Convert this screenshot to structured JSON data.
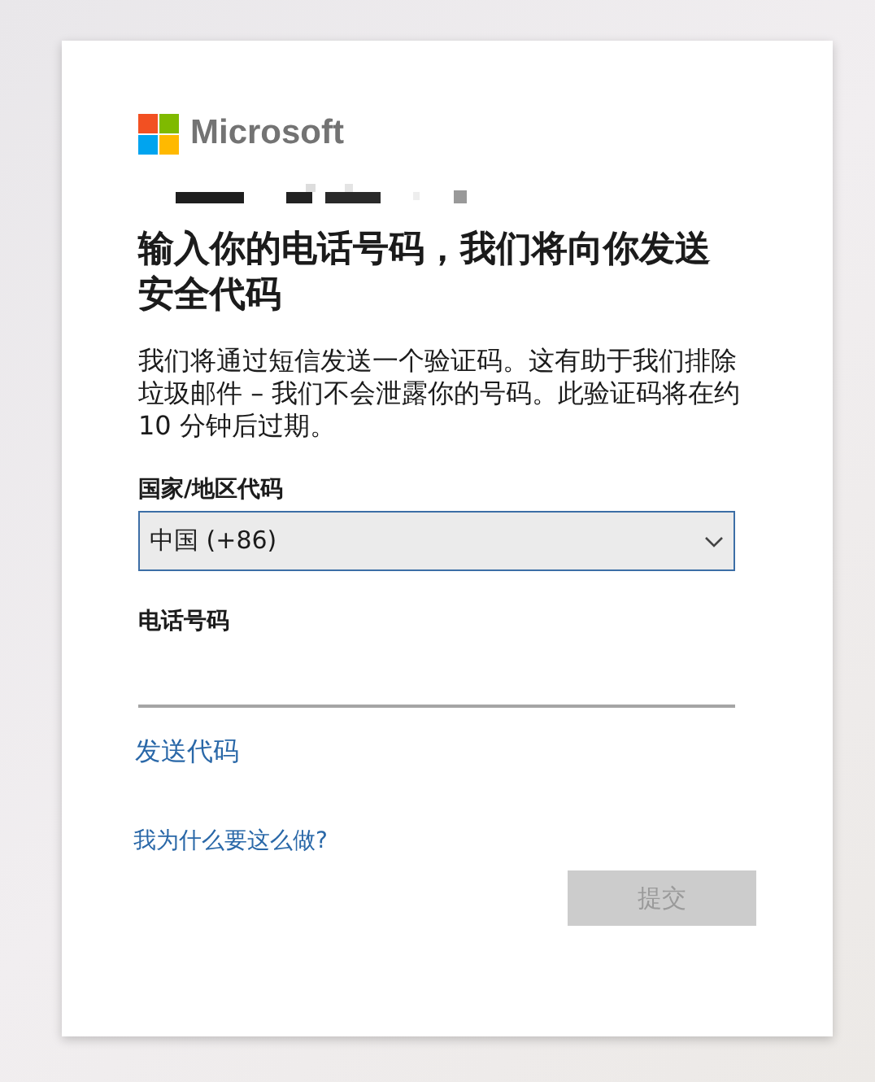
{
  "brand": {
    "name": "Microsoft"
  },
  "heading": "输入你的电话号码，我们将向你发送安全代码",
  "description": "我们将通过短信发送一个验证码。这有助于我们排除垃圾邮件 – 我们不会泄露你的号码。此验证码将在约 10 分钟后过期。",
  "country_field": {
    "label": "国家/地区代码",
    "value": "中国 (+86)"
  },
  "phone_field": {
    "label": "电话号码"
  },
  "send_code_link": "发送代码",
  "why_link": "我为什么要这么做?",
  "submit_button": {
    "label": "提交",
    "disabled": true
  }
}
